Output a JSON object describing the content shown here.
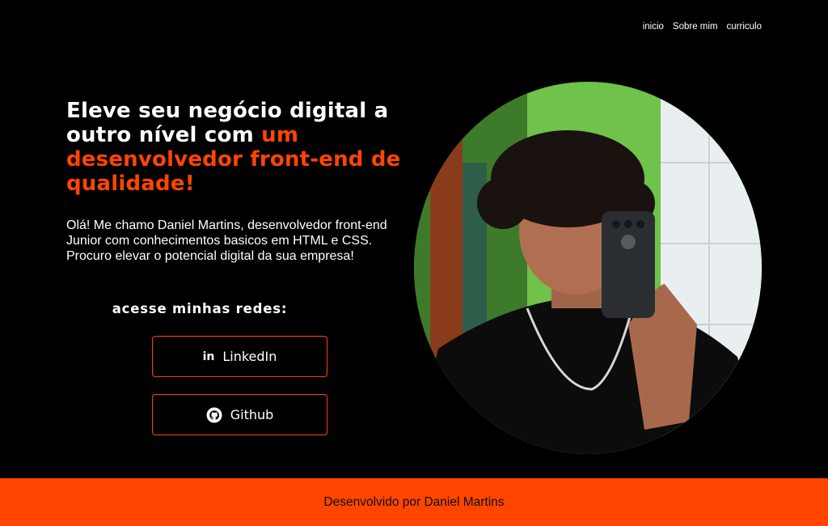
{
  "nav": {
    "items": [
      {
        "label": "inicio"
      },
      {
        "label": "Sobre mim"
      },
      {
        "label": "curriculo"
      }
    ]
  },
  "hero": {
    "headline_white": "Eleve seu negócio digital a outro nível com ",
    "headline_accent": "um desenvolvedor front-end de qualidade!",
    "intro": "Olá! Me chamo Daniel Martins, desenvolvedor front-end Junior com conhecimentos basicos em HTML e CSS. Procuro elevar o potencial digital da sua empresa!"
  },
  "socials": {
    "title": "acesse minhas redes:",
    "linkedin": {
      "label": "LinkedIn",
      "icon_text": "in",
      "icon": "linkedin-icon"
    },
    "github": {
      "label": "Github",
      "icon": "github-icon"
    }
  },
  "footer": {
    "text": "Desenvolvido por Daniel Martins"
  },
  "colors": {
    "background": "#000000",
    "accent": "#ff4500",
    "text": "#ffffff"
  }
}
